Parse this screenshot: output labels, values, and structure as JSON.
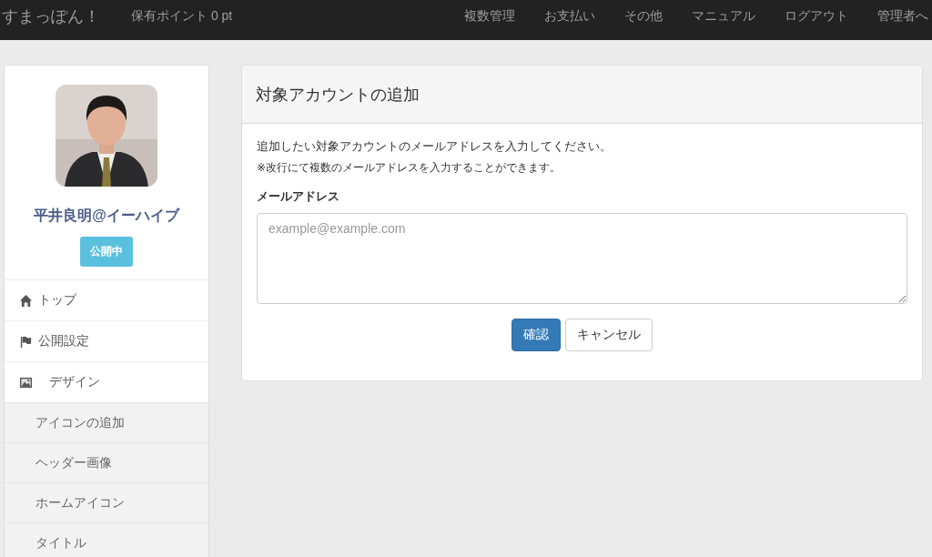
{
  "navbar": {
    "brand": "すまっぽん！",
    "points": "保有ポイント 0 pt",
    "links": [
      "複数管理",
      "お支払い",
      "その他",
      "マニュアル",
      "ログアウト",
      "管理者へ"
    ]
  },
  "sidebar": {
    "name": "平井良明@イーハイブ",
    "status_badge": "公開中",
    "items": [
      {
        "label": "トップ"
      },
      {
        "label": "公開設定"
      },
      {
        "label": "デザイン",
        "children": [
          {
            "label": "アイコンの追加"
          },
          {
            "label": "ヘッダー画像"
          },
          {
            "label": "ホームアイコン"
          },
          {
            "label": "タイトル"
          }
        ]
      }
    ]
  },
  "panel": {
    "title": "対象アカウントの追加",
    "instruction": "追加したい対象アカウントのメールアドレスを入力してください。",
    "note": "※改行にて複数のメールアドレスを入力することができます。",
    "field_label": "メールアドレス",
    "email_field": {
      "placeholder": "example@example.com"
    },
    "buttons": [
      "確認",
      "キャンセル"
    ]
  }
}
